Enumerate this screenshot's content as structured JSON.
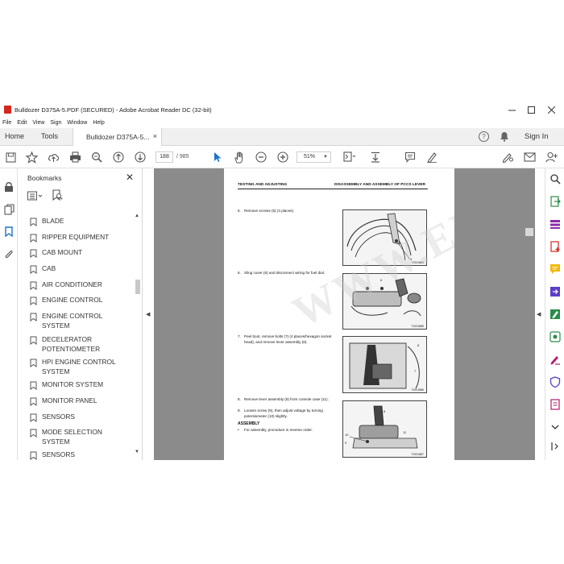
{
  "window": {
    "title": "Bulldozer D375A-5.PDF (SECURED) - Adobe Acrobat Reader DC (32-bit)",
    "controls": [
      "minimize",
      "maximize",
      "close"
    ]
  },
  "menu": [
    "File",
    "Edit",
    "View",
    "Sign",
    "Window",
    "Help"
  ],
  "tabs": {
    "home": "Home",
    "tools": "Tools",
    "doc": "Bulldozer D375A-5...",
    "doc_close": "×",
    "sign_in": "Sign In"
  },
  "toolbar": {
    "page_current": "188",
    "page_total": "/ 985",
    "zoom": "51%",
    "zoom_caret": "▼"
  },
  "bookmarks": {
    "title": "Bookmarks",
    "close": "✕",
    "items": [
      "BLADE",
      "RIPPER EQUIPMENT",
      "CAB MOUNT",
      "CAB",
      "AIR CONDITIONER",
      "ENGINE CONTROL",
      "ENGINE CONTROL SYSTEM",
      "DECELERATOR POTENTIOMETER",
      "HPI ENGINE CONTROL SYSTEM",
      "MONITOR SYSTEM",
      "MONITOR PANEL",
      "SENSORS",
      "MODE SELECTION SYSTEM",
      "SENSORS"
    ],
    "scroll_up": "▲",
    "scroll_down": "▼"
  },
  "panels": {
    "left_collapse": "◀",
    "right_collapse": "◀"
  },
  "document": {
    "header_left": "TESTING AND ADJUSTING",
    "header_right": "DISASSEMBLY AND ASSEMBLY OF PCCS LEVER",
    "steps": [
      {
        "num": "5.",
        "text": "Remove screws (5) (4 places)."
      },
      {
        "num": "6.",
        "text": "Sling cover (6) and disconnect wiring for fuel dial."
      },
      {
        "num": "7.",
        "text": "Peel boot, remove bolts (7) (4 places/hexagon socket head), and remove lever assembly (8)."
      },
      {
        "num": "8.",
        "text": "Remove lever assembly (8) from console case (11)."
      },
      {
        "num": "9.",
        "text": "Loosen screw (9), then adjust voltage by turning potentiometer (10) slightly."
      }
    ],
    "assembly_heading": "ASSEMBLY",
    "assembly_note": "For assembly, procedure in reverse order.",
    "assembly_bullet": "•",
    "figure_codes": [
      "TJ001884",
      "TJ001885",
      "TJ001886",
      "TJ001887"
    ],
    "watermark": "WWW.EPCDEPOT.COM"
  }
}
